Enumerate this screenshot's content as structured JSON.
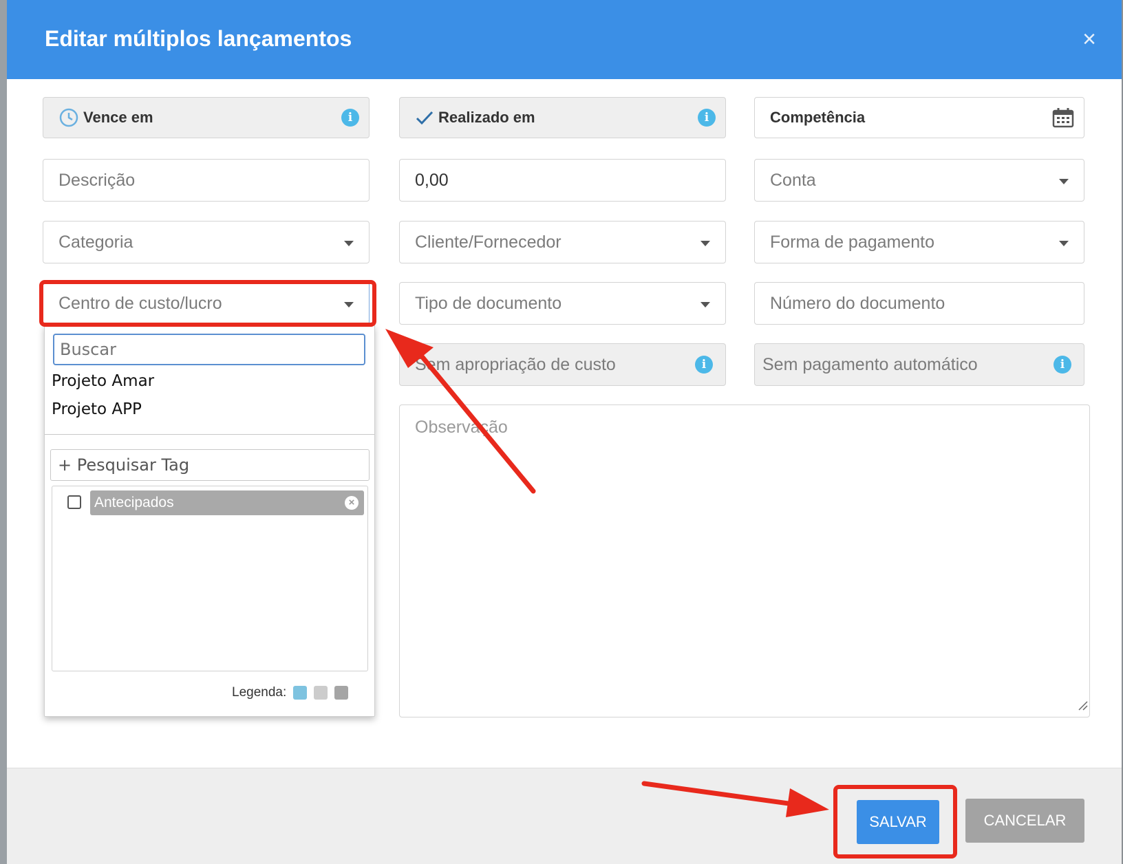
{
  "modal": {
    "title": "Editar múltiplos lançamentos",
    "close_label": "×"
  },
  "fields": {
    "vence_em": "Vence em",
    "realizado_em": "Realizado em",
    "competencia": "Competência",
    "descricao_placeholder": "Descrição",
    "valor": "0,00",
    "conta": "Conta",
    "categoria": "Categoria",
    "cliente_fornecedor": "Cliente/Fornecedor",
    "forma_pagamento": "Forma de pagamento",
    "centro_custo": "Centro de custo/lucro",
    "tipo_documento": "Tipo de documento",
    "numero_documento_placeholder": "Número do documento",
    "apropriacao": "Sem apropriação de custo",
    "pagamento_automatico": "Sem pagamento automático",
    "observacao_placeholder": "Observação"
  },
  "dropdown": {
    "search_placeholder": "Buscar",
    "options": [
      "Projeto Amar",
      "Projeto APP"
    ]
  },
  "tags": {
    "search_label": "+ Pesquisar Tag",
    "items": [
      {
        "label": "Antecipados",
        "checked": false
      }
    ],
    "legend_label": "Legenda:",
    "legend_colors": [
      "#7ec3e0",
      "#cccccc",
      "#a5a5a5"
    ]
  },
  "footer": {
    "save_label": "SALVAR",
    "cancel_label": "CANCELAR"
  },
  "colors": {
    "header": "#3b8fe6",
    "annotation": "#e8291c",
    "info": "#4cb8e8"
  }
}
